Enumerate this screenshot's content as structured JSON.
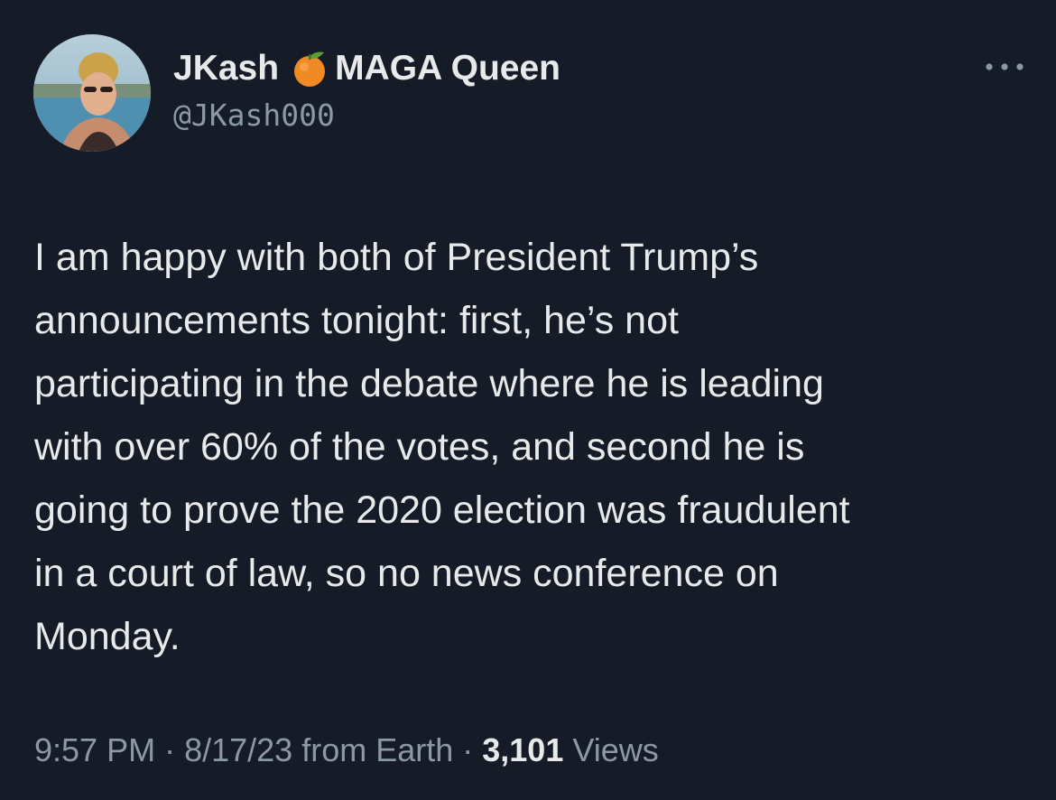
{
  "author": {
    "display_name_part1": "JKash",
    "emoji_icon": "tangerine-icon",
    "display_name_part2": "MAGA Queen",
    "handle": "@JKash000"
  },
  "tweet": {
    "text": "I am happy with both of President Trump’s\nannouncements tonight:  first, he’s not\nparticipating in the debate where he is leading\nwith over 60% of the votes, and second he is\ngoing to prove the 2020 election was fraudulent\nin a court of law, so no news conference on\nMonday."
  },
  "meta": {
    "time": "9:57 PM",
    "separator1": " · ",
    "date": "8/17/23",
    "source": " from Earth",
    "separator2": " · ",
    "views_count": "3,101",
    "views_label": " Views"
  },
  "colors": {
    "background": "#161c27",
    "text_primary": "#e7e9ea",
    "text_secondary": "#8b98a5"
  }
}
